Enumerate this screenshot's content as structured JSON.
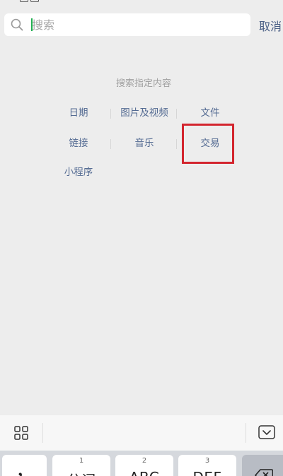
{
  "search": {
    "placeholder": "搜索",
    "cancel_label": "取消"
  },
  "section": {
    "title": "搜索指定内容"
  },
  "categories": [
    {
      "label": "日期"
    },
    {
      "label": "图片及视频"
    },
    {
      "label": "文件"
    },
    {
      "label": "链接"
    },
    {
      "label": "音乐"
    },
    {
      "label": "交易"
    },
    {
      "label": "小程序"
    }
  ],
  "keyboard": {
    "keys": [
      {
        "num": "",
        "label": "，"
      },
      {
        "num": "1",
        "label": "分词"
      },
      {
        "num": "2",
        "label": "ABC"
      },
      {
        "num": "3",
        "label": "DEF"
      }
    ]
  },
  "colors": {
    "background": "#ededed",
    "link_blue": "#536a92",
    "cancel_blue": "#4a5f85",
    "cursor_green": "#20b050",
    "highlight_red": "#d3252e"
  }
}
